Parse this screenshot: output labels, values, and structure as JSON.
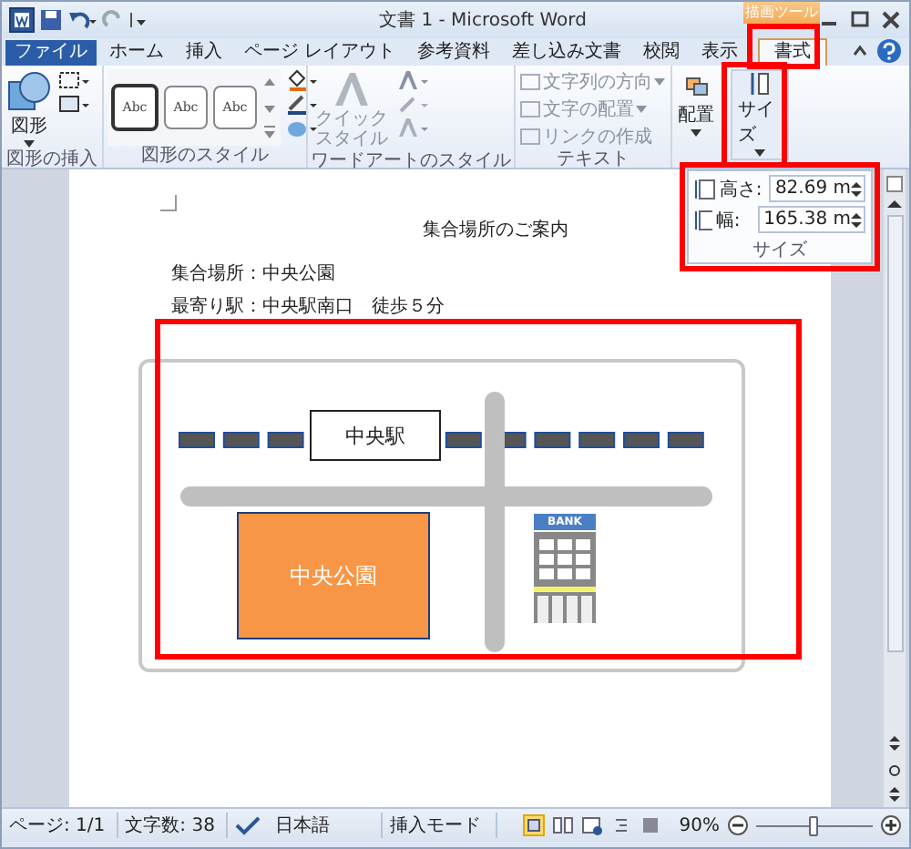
{
  "window": {
    "title": "文書 1 - Microsoft Word"
  },
  "context_tab": {
    "label": "描画ツール"
  },
  "tabs": [
    {
      "label": "ファイル",
      "selected": false,
      "kind": "file"
    },
    {
      "label": "ホーム",
      "selected": false,
      "kind": "tab"
    },
    {
      "label": "挿入",
      "selected": false,
      "kind": "tab"
    },
    {
      "label": "ページ レイアウト",
      "selected": false,
      "kind": "tab"
    },
    {
      "label": "参考資料",
      "selected": false,
      "kind": "tab"
    },
    {
      "label": "差し込み文書",
      "selected": false,
      "kind": "tab"
    },
    {
      "label": "校閲",
      "selected": false,
      "kind": "tab"
    },
    {
      "label": "表示",
      "selected": false,
      "kind": "tab"
    },
    {
      "label": "書式",
      "selected": true,
      "kind": "context"
    }
  ],
  "ribbon": {
    "insert_shapes": {
      "button": "図形",
      "label": "図形の挿入"
    },
    "shape_styles": {
      "samples": [
        "Abc",
        "Abc",
        "Abc"
      ],
      "label": "図形のスタイル"
    },
    "wordart_styles": {
      "button": "クイックスタイル",
      "label": "ワードアートのスタイル",
      "disabled": true
    },
    "text": {
      "label": "テキスト",
      "commands": [
        {
          "label": "文字列の方向",
          "dropdown": true,
          "disabled": true
        },
        {
          "label": "文字の配置",
          "dropdown": true,
          "disabled": true
        },
        {
          "label": "リンクの作成",
          "dropdown": false,
          "disabled": true
        }
      ]
    },
    "arrange": {
      "button": "配置"
    },
    "size": {
      "button": "サイズ"
    }
  },
  "size_panel": {
    "label": "サイズ",
    "fields": [
      {
        "label": "高さ:",
        "value": "82.69 m"
      },
      {
        "label": "幅:",
        "value": "165.38 m"
      }
    ]
  },
  "document": {
    "title": "集合場所のご案内",
    "lines": [
      "集合場所：中央公園",
      "最寄り駅：中央駅南口　徒歩５分"
    ],
    "map": {
      "station": "中央駅",
      "park": "中央公園",
      "bank_sign": "BANK"
    }
  },
  "status_bar": {
    "page": "ページ: 1/1",
    "word_count": "文字数: 38",
    "language": "日本語",
    "mode": "挿入モード",
    "zoom": "90%",
    "zoom_slider": {
      "level": 0.48
    }
  }
}
